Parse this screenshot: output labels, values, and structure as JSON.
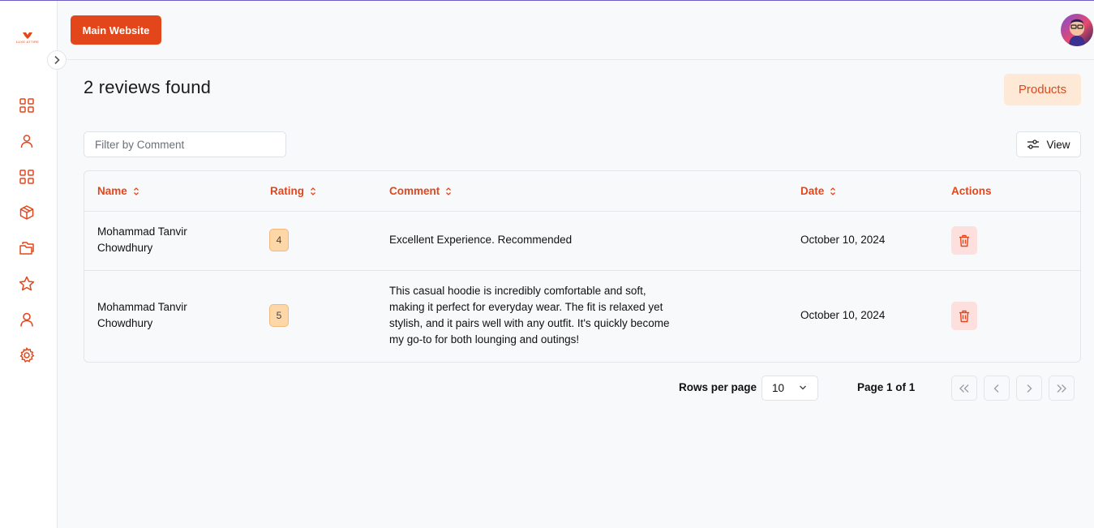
{
  "brand": {
    "logo_text": "LUXE ATTIRE",
    "accent_color": "#e4461b"
  },
  "sidebar": {
    "items": [
      {
        "icon": "dashboard-icon"
      },
      {
        "icon": "user-icon"
      },
      {
        "icon": "grid-icon"
      },
      {
        "icon": "package-icon"
      },
      {
        "icon": "collections-icon"
      },
      {
        "icon": "star-icon"
      },
      {
        "icon": "account-icon"
      },
      {
        "icon": "settings-icon"
      }
    ]
  },
  "topbar": {
    "main_website_label": "Main Website"
  },
  "page": {
    "title": "2 reviews found",
    "products_label": "Products",
    "filter_placeholder": "Filter by Comment",
    "view_label": "View"
  },
  "table": {
    "headers": {
      "name": "Name",
      "rating": "Rating",
      "comment": "Comment",
      "date": "Date",
      "actions": "Actions"
    },
    "rows": [
      {
        "name_line1": "Mohammad Tanvir",
        "name_line2": "Chowdhury",
        "rating": "4",
        "comment": "Excellent Experience. Recommended",
        "date": "October 10, 2024"
      },
      {
        "name_line1": "Mohammad Tanvir",
        "name_line2": "Chowdhury",
        "rating": "5",
        "comment": "This casual hoodie is incredibly comfortable and soft, making it perfect for everyday wear. The fit is relaxed yet stylish, and it pairs well with any outfit. It's quickly become my go-to for both lounging and outings!",
        "date": "October 10, 2024"
      }
    ]
  },
  "pagination": {
    "rows_per_page_label": "Rows per page",
    "rows_per_page_value": "10",
    "page_info": "Page 1 of 1"
  }
}
